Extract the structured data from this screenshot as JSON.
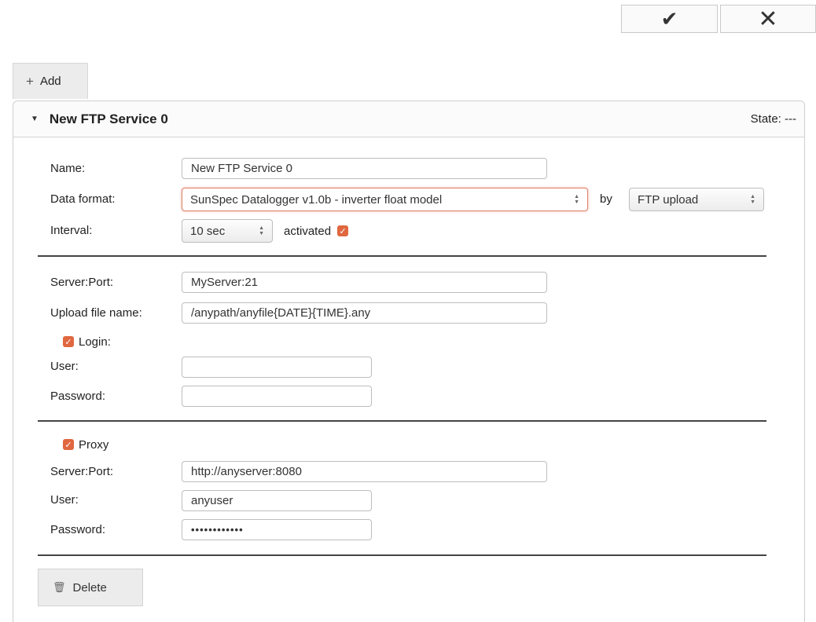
{
  "toolbar": {
    "confirm_icon": "checkmark-icon",
    "cancel_icon": "close-icon",
    "confirm_glyph": "✔",
    "cancel_glyph": "✕"
  },
  "add_button": {
    "icon": "+",
    "label": "Add"
  },
  "service": {
    "title": "New FTP Service 0",
    "state_label": "State: ---",
    "name_label": "Name:",
    "name_value": "New FTP Service 0",
    "data_format_label": "Data format:",
    "data_format_value": "SunSpec Datalogger v1.0b - inverter float model",
    "by_label": "by",
    "transport_value": "FTP upload",
    "interval_label": "Interval:",
    "interval_value": "10 sec",
    "activated_label": "activated",
    "activated_checked": true,
    "server_port_label": "Server:Port:",
    "server_port_value": "MyServer:21",
    "upload_file_label": "Upload file name:",
    "upload_file_value": "/anypath/anyfile{DATE}{TIME}.any",
    "login_label": "Login:",
    "login_checked": true,
    "user_label": "User:",
    "user_value": "",
    "password_label": "Password:",
    "password_value": "",
    "proxy_label": "Proxy",
    "proxy_checked": true,
    "proxy_server_port_label": "Server:Port:",
    "proxy_server_port_value": "http://anyserver:8080",
    "proxy_user_label": "User:",
    "proxy_user_value": "anyuser",
    "proxy_password_label": "Password:",
    "proxy_password_value": "••••••••••••",
    "delete_label": "Delete"
  },
  "colors": {
    "checkbox": "#e0673f",
    "active_border": "#e0826a",
    "divider": "#444444"
  }
}
